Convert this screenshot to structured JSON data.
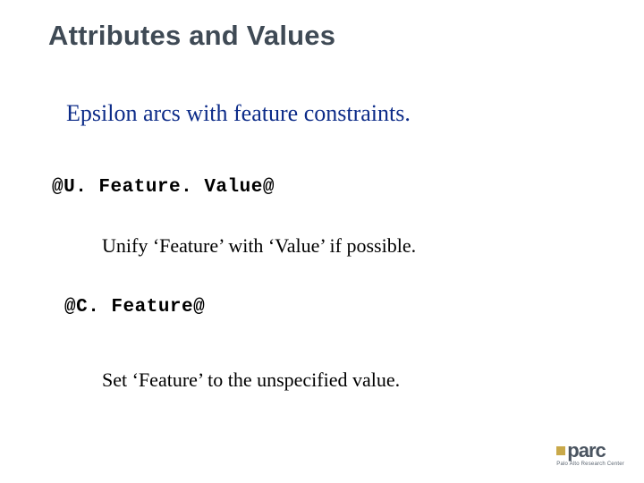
{
  "title": "Attributes and Values",
  "subtitle": "Epsilon arcs with feature constraints.",
  "items": [
    {
      "code": "@U. Feature. Value@",
      "desc": "Unify ‘Feature’ with ‘Value’ if possible."
    },
    {
      "code": "@C. Feature@",
      "desc": "Set ‘Feature’ to the unspecified value."
    }
  ],
  "logo": {
    "text": "parc",
    "subtitle": "Palo Alto Research Center"
  }
}
